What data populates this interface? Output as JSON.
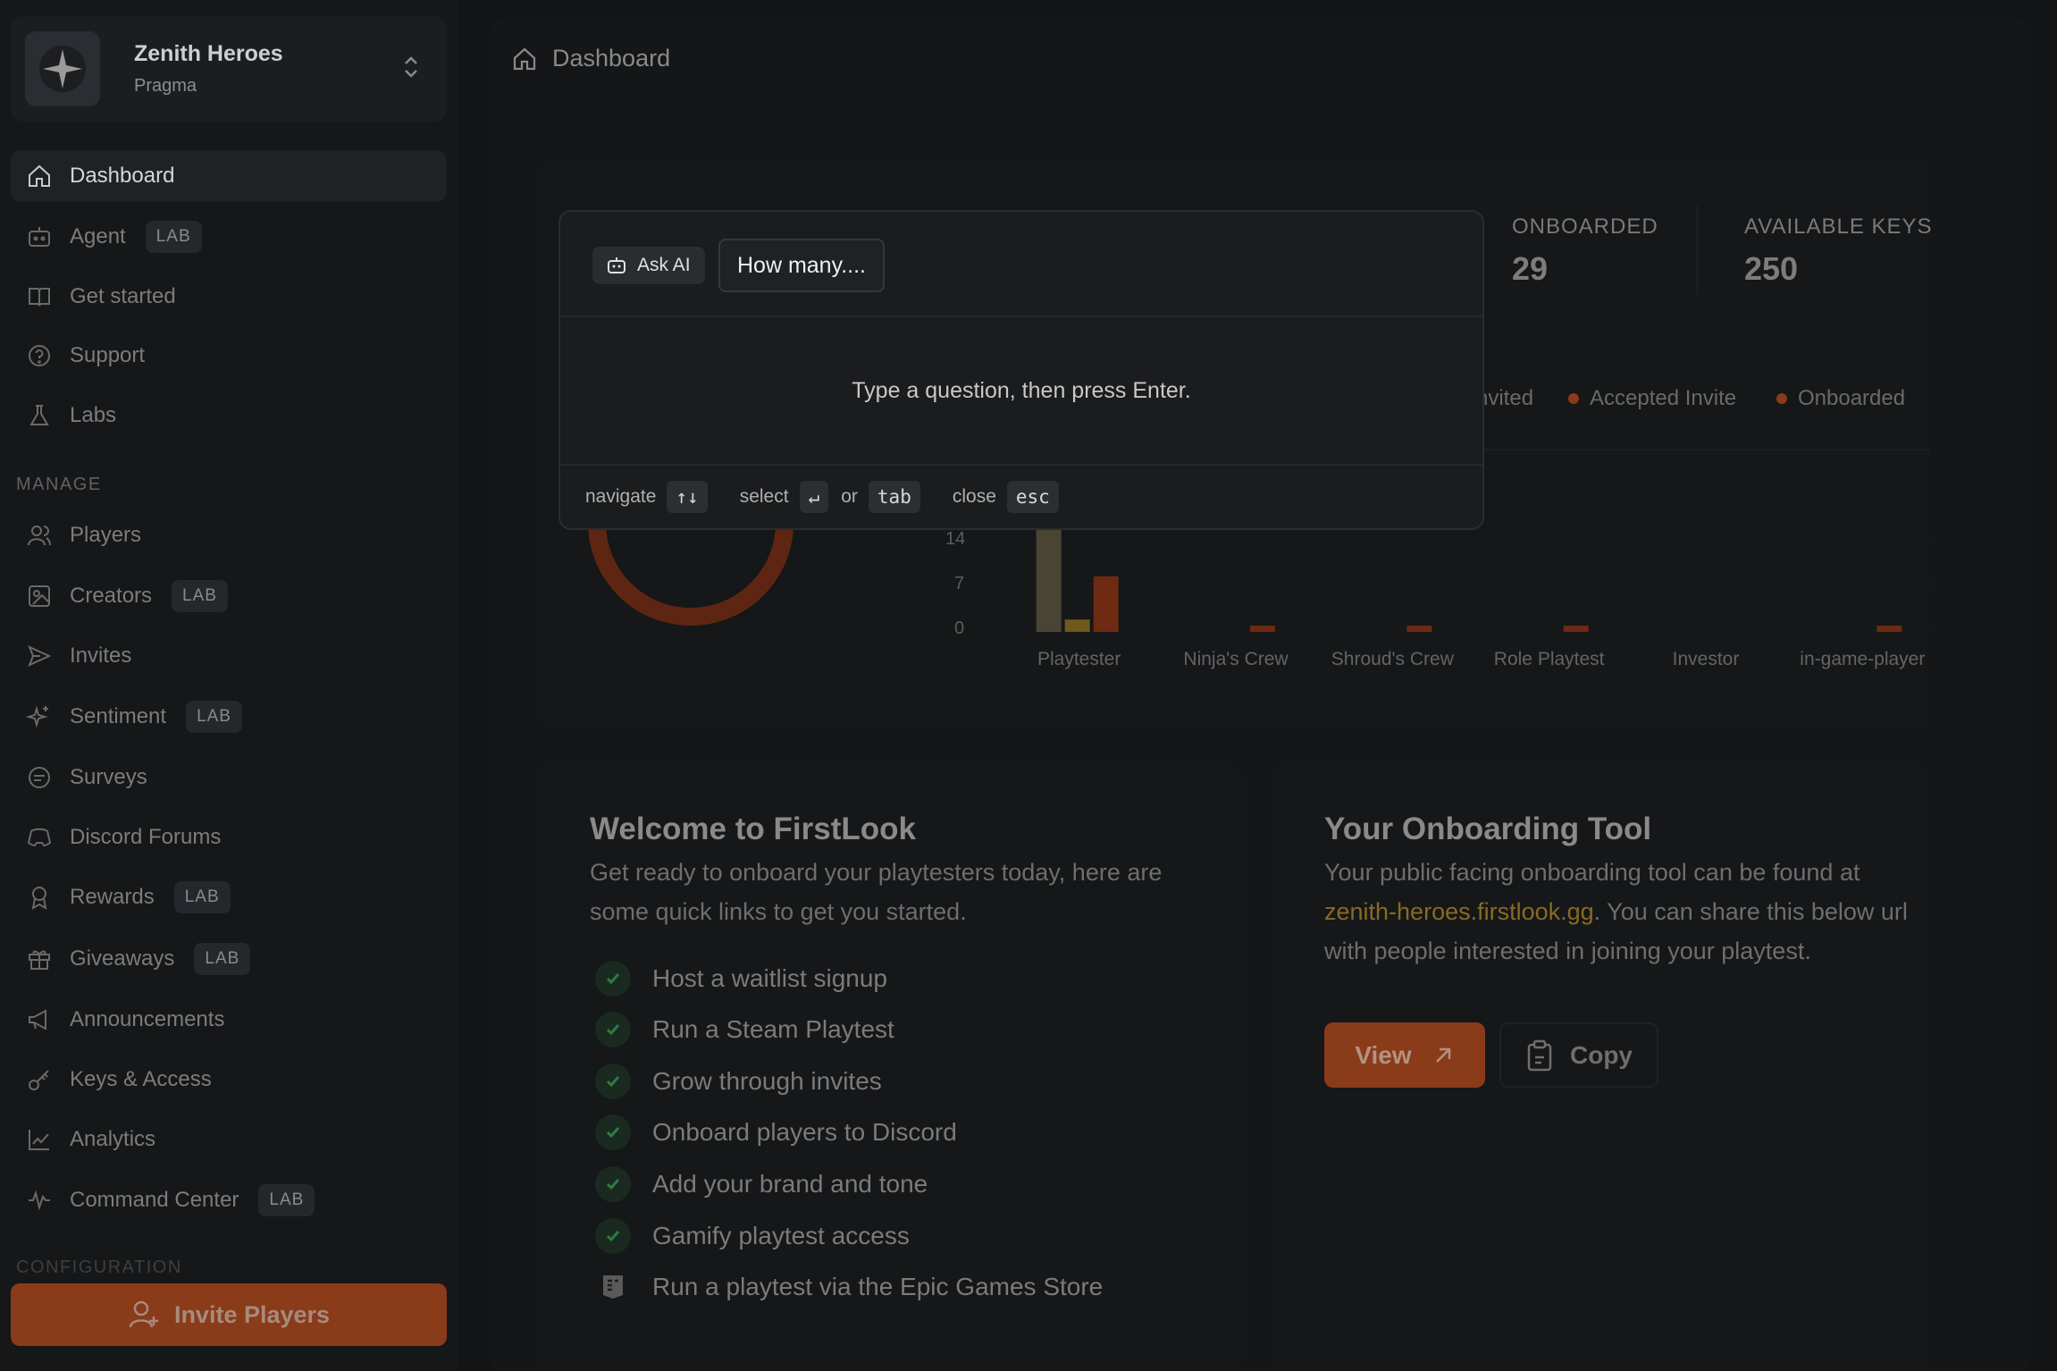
{
  "team": {
    "name": "Zenith Heroes",
    "org": "Pragma"
  },
  "nav_primary": [
    {
      "label": "Dashboard",
      "icon": "home-icon",
      "active": true
    },
    {
      "label": "Agent",
      "icon": "robot-icon",
      "badge": "LAB"
    },
    {
      "label": "Get started",
      "icon": "book-icon"
    },
    {
      "label": "Support",
      "icon": "help-icon"
    },
    {
      "label": "Labs",
      "icon": "flask-icon"
    }
  ],
  "manage_label": "MANAGE",
  "nav_manage": [
    {
      "label": "Players",
      "icon": "users-icon"
    },
    {
      "label": "Creators",
      "icon": "creators-icon",
      "badge": "LAB"
    },
    {
      "label": "Invites",
      "icon": "send-icon"
    },
    {
      "label": "Sentiment",
      "icon": "sparkle-icon",
      "badge": "LAB"
    },
    {
      "label": "Surveys",
      "icon": "chat-icon"
    },
    {
      "label": "Discord Forums",
      "icon": "discord-icon"
    },
    {
      "label": "Rewards",
      "icon": "award-icon",
      "badge": "LAB"
    },
    {
      "label": "Giveaways",
      "icon": "gift-icon",
      "badge": "LAB"
    },
    {
      "label": "Announcements",
      "icon": "megaphone-icon"
    },
    {
      "label": "Keys & Access",
      "icon": "key-icon"
    },
    {
      "label": "Analytics",
      "icon": "chart-icon"
    },
    {
      "label": "Command Center",
      "icon": "activity-icon",
      "badge": "LAB"
    }
  ],
  "config_label": "CONFIGURATION",
  "invite_button": "Invite Players",
  "breadcrumb": "Dashboard",
  "stats": [
    {
      "label": "ONBOARDED",
      "value": "29"
    },
    {
      "label": "AVAILABLE KEYS",
      "value": "250"
    }
  ],
  "legend": [
    "nvited",
    "Accepted Invite",
    "Onboarded"
  ],
  "chart_data": {
    "type": "bar",
    "categories": [
      "Playtester",
      "Ninja's Crew",
      "Shroud's Crew",
      "Role Playtest",
      "Investor",
      "in-game-player"
    ],
    "y_ticks": [
      "14",
      "7",
      "0"
    ],
    "series": [
      {
        "name": "Invited",
        "values": [
          20,
          0,
          0,
          0,
          0,
          0
        ]
      },
      {
        "name": "Accepted Invite",
        "values": [
          2,
          0,
          0,
          0,
          0,
          0
        ]
      },
      {
        "name": "Onboarded",
        "values": [
          9,
          1,
          1,
          1,
          0,
          1
        ]
      }
    ]
  },
  "welcome": {
    "title": "Welcome to FirstLook",
    "text": "Get ready to onboard your playtesters today, here are some quick links to get you started.",
    "items": [
      {
        "label": "Host a waitlist signup",
        "done": true
      },
      {
        "label": "Run a Steam Playtest",
        "done": true
      },
      {
        "label": "Grow through invites",
        "done": true
      },
      {
        "label": "Onboard players to Discord",
        "done": true
      },
      {
        "label": "Add your brand and tone",
        "done": true
      },
      {
        "label": "Gamify playtest access",
        "done": true
      },
      {
        "label": "Run a playtest via the Epic Games Store",
        "done": false
      }
    ]
  },
  "onboarding": {
    "title": "Your Onboarding Tool",
    "text_before": "Your public facing onboarding tool can be found at",
    "link": "zenith-heroes.firstlook.gg",
    "text_after": ". You can share this below url with people interested in joining your playtest.",
    "view_label": "View",
    "copy_label": "Copy"
  },
  "modal": {
    "ask_ai_label": "Ask AI",
    "query": "How many....",
    "hint": "Type a question, then press Enter.",
    "navigate_label": "navigate",
    "navigate_key": "↑↓",
    "select_label": "select",
    "select_key": "↵",
    "or_label": "or",
    "tab_key": "tab",
    "close_label": "close",
    "close_key": "esc"
  },
  "colors": {
    "accent": "#8a3b1a",
    "bar_invited": "#4a4533",
    "bar_accepted": "#6e5a1c",
    "bar_onboarded": "#6e2a12"
  }
}
